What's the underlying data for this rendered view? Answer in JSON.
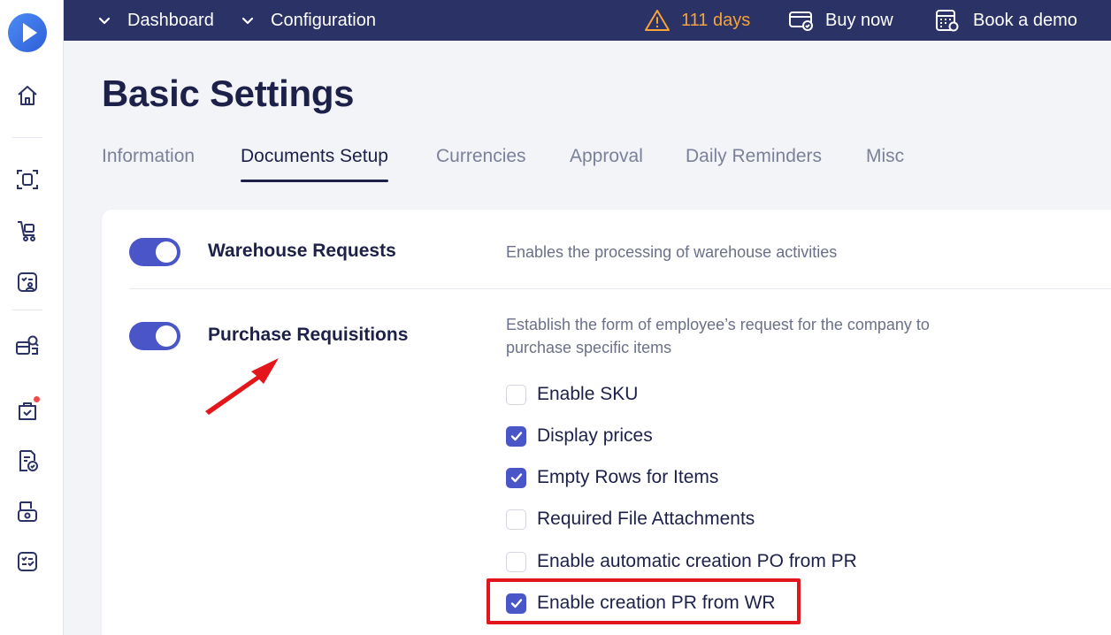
{
  "topbar": {
    "dashboard_label": "Dashboard",
    "configuration_label": "Configuration",
    "trial_days": "111 days",
    "buy_now_label": "Buy now",
    "book_demo_label": "Book a demo"
  },
  "page": {
    "title": "Basic Settings"
  },
  "tabs": [
    {
      "label": "Information"
    },
    {
      "label": "Documents Setup",
      "active": true
    },
    {
      "label": "Currencies"
    },
    {
      "label": "Approval"
    },
    {
      "label": "Daily Reminders"
    },
    {
      "label": "Misc"
    }
  ],
  "settings": {
    "warehouse": {
      "title": "Warehouse Requests",
      "description": "Enables the processing of warehouse activities",
      "enabled": true
    },
    "purchase": {
      "title": "Purchase Requisitions",
      "description_line1": "Establish the form of employee’s request for the company to",
      "description_line2": "purchase specific items",
      "enabled": true,
      "options": [
        {
          "label": "Enable SKU",
          "checked": false
        },
        {
          "label": "Display prices",
          "checked": true
        },
        {
          "label": "Empty Rows for Items",
          "checked": true
        },
        {
          "label": "Required File Attachments",
          "checked": false
        },
        {
          "label": "Enable automatic creation PO from PR",
          "checked": false
        },
        {
          "label": "Enable creation PR from WR",
          "checked": true
        }
      ]
    }
  },
  "colors": {
    "topbar": "#2b3266",
    "accent": "#4a55c8",
    "warning": "#f5a33a",
    "highlight": "#e3171b"
  }
}
